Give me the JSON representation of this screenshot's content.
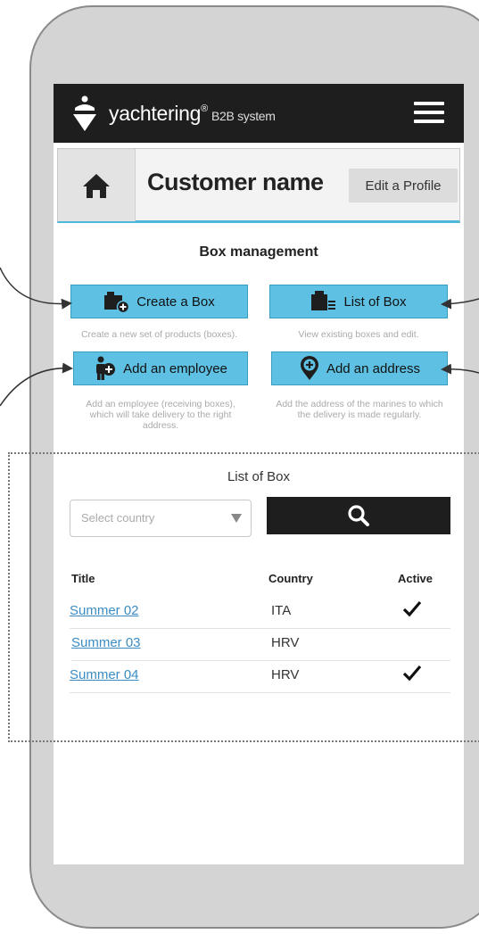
{
  "header": {
    "brand": "yachtering",
    "brand_mark": "®",
    "subtitle": "B2B system"
  },
  "profile": {
    "customer_name": "Customer name",
    "edit_label": "Edit a Profile"
  },
  "box_management": {
    "title": "Box management",
    "actions": [
      {
        "label": "Create a Box",
        "icon": "box-add-icon",
        "description": "Create a new set of products (boxes)."
      },
      {
        "label": "List of Box",
        "icon": "box-list-icon",
        "description": "View existing boxes and edit."
      },
      {
        "label": "Add an employee",
        "icon": "employee-add-icon",
        "description": "Add an employee (receiving boxes), which will take delivery to the right address."
      },
      {
        "label": "Add an address",
        "icon": "address-pin-icon",
        "description": "Add the address of the marines to which the delivery is made regularly."
      }
    ]
  },
  "list": {
    "title": "List of Box",
    "select_placeholder": "Select country",
    "columns": [
      "Title",
      "Country",
      "Active"
    ],
    "rows": [
      {
        "title": "Summer 02",
        "country": "ITA",
        "active": true
      },
      {
        "title": "Summer 03",
        "country": "HRV",
        "active": false
      },
      {
        "title": "Summer 04",
        "country": "HRV",
        "active": true
      }
    ]
  },
  "colors": {
    "accent": "#5ec1e3",
    "topbar": "#1e1e1e",
    "link": "#3a8dc4"
  }
}
